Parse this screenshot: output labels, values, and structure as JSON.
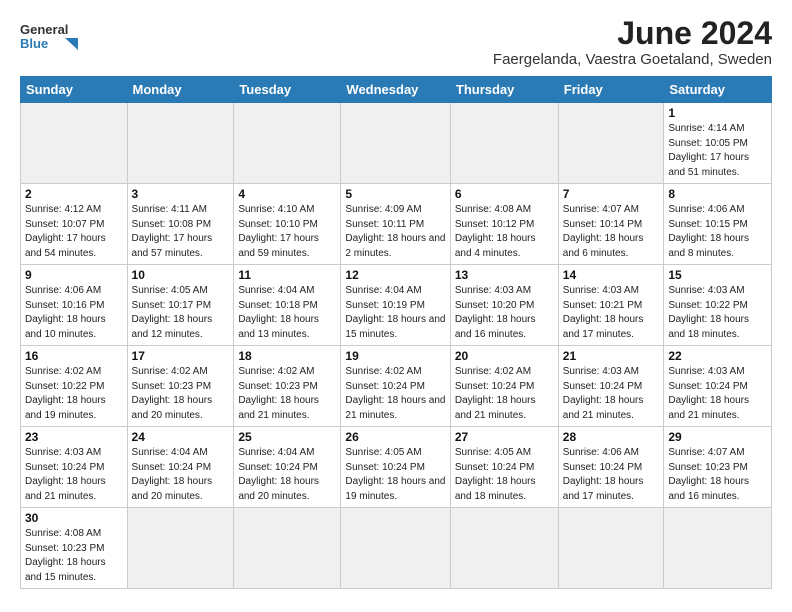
{
  "header": {
    "logo_general": "General",
    "logo_blue": "Blue",
    "month_title": "June 2024",
    "subtitle": "Faergelanda, Vaestra Goetaland, Sweden"
  },
  "weekdays": [
    "Sunday",
    "Monday",
    "Tuesday",
    "Wednesday",
    "Thursday",
    "Friday",
    "Saturday"
  ],
  "weeks": [
    [
      {
        "day": "",
        "info": ""
      },
      {
        "day": "",
        "info": ""
      },
      {
        "day": "",
        "info": ""
      },
      {
        "day": "",
        "info": ""
      },
      {
        "day": "",
        "info": ""
      },
      {
        "day": "",
        "info": ""
      },
      {
        "day": "1",
        "info": "Sunrise: 4:14 AM\nSunset: 10:05 PM\nDaylight: 17 hours and 51 minutes."
      }
    ],
    [
      {
        "day": "2",
        "info": "Sunrise: 4:12 AM\nSunset: 10:07 PM\nDaylight: 17 hours and 54 minutes."
      },
      {
        "day": "3",
        "info": "Sunrise: 4:11 AM\nSunset: 10:08 PM\nDaylight: 17 hours and 57 minutes."
      },
      {
        "day": "4",
        "info": "Sunrise: 4:10 AM\nSunset: 10:10 PM\nDaylight: 17 hours and 59 minutes."
      },
      {
        "day": "5",
        "info": "Sunrise: 4:09 AM\nSunset: 10:11 PM\nDaylight: 18 hours and 2 minutes."
      },
      {
        "day": "6",
        "info": "Sunrise: 4:08 AM\nSunset: 10:12 PM\nDaylight: 18 hours and 4 minutes."
      },
      {
        "day": "7",
        "info": "Sunrise: 4:07 AM\nSunset: 10:14 PM\nDaylight: 18 hours and 6 minutes."
      },
      {
        "day": "8",
        "info": "Sunrise: 4:06 AM\nSunset: 10:15 PM\nDaylight: 18 hours and 8 minutes."
      }
    ],
    [
      {
        "day": "9",
        "info": "Sunrise: 4:06 AM\nSunset: 10:16 PM\nDaylight: 18 hours and 10 minutes."
      },
      {
        "day": "10",
        "info": "Sunrise: 4:05 AM\nSunset: 10:17 PM\nDaylight: 18 hours and 12 minutes."
      },
      {
        "day": "11",
        "info": "Sunrise: 4:04 AM\nSunset: 10:18 PM\nDaylight: 18 hours and 13 minutes."
      },
      {
        "day": "12",
        "info": "Sunrise: 4:04 AM\nSunset: 10:19 PM\nDaylight: 18 hours and 15 minutes."
      },
      {
        "day": "13",
        "info": "Sunrise: 4:03 AM\nSunset: 10:20 PM\nDaylight: 18 hours and 16 minutes."
      },
      {
        "day": "14",
        "info": "Sunrise: 4:03 AM\nSunset: 10:21 PM\nDaylight: 18 hours and 17 minutes."
      },
      {
        "day": "15",
        "info": "Sunrise: 4:03 AM\nSunset: 10:22 PM\nDaylight: 18 hours and 18 minutes."
      }
    ],
    [
      {
        "day": "16",
        "info": "Sunrise: 4:02 AM\nSunset: 10:22 PM\nDaylight: 18 hours and 19 minutes."
      },
      {
        "day": "17",
        "info": "Sunrise: 4:02 AM\nSunset: 10:23 PM\nDaylight: 18 hours and 20 minutes."
      },
      {
        "day": "18",
        "info": "Sunrise: 4:02 AM\nSunset: 10:23 PM\nDaylight: 18 hours and 21 minutes."
      },
      {
        "day": "19",
        "info": "Sunrise: 4:02 AM\nSunset: 10:24 PM\nDaylight: 18 hours and 21 minutes."
      },
      {
        "day": "20",
        "info": "Sunrise: 4:02 AM\nSunset: 10:24 PM\nDaylight: 18 hours and 21 minutes."
      },
      {
        "day": "21",
        "info": "Sunrise: 4:03 AM\nSunset: 10:24 PM\nDaylight: 18 hours and 21 minutes."
      },
      {
        "day": "22",
        "info": "Sunrise: 4:03 AM\nSunset: 10:24 PM\nDaylight: 18 hours and 21 minutes."
      }
    ],
    [
      {
        "day": "23",
        "info": "Sunrise: 4:03 AM\nSunset: 10:24 PM\nDaylight: 18 hours and 21 minutes."
      },
      {
        "day": "24",
        "info": "Sunrise: 4:04 AM\nSunset: 10:24 PM\nDaylight: 18 hours and 20 minutes."
      },
      {
        "day": "25",
        "info": "Sunrise: 4:04 AM\nSunset: 10:24 PM\nDaylight: 18 hours and 20 minutes."
      },
      {
        "day": "26",
        "info": "Sunrise: 4:05 AM\nSunset: 10:24 PM\nDaylight: 18 hours and 19 minutes."
      },
      {
        "day": "27",
        "info": "Sunrise: 4:05 AM\nSunset: 10:24 PM\nDaylight: 18 hours and 18 minutes."
      },
      {
        "day": "28",
        "info": "Sunrise: 4:06 AM\nSunset: 10:24 PM\nDaylight: 18 hours and 17 minutes."
      },
      {
        "day": "29",
        "info": "Sunrise: 4:07 AM\nSunset: 10:23 PM\nDaylight: 18 hours and 16 minutes."
      }
    ],
    [
      {
        "day": "30",
        "info": "Sunrise: 4:08 AM\nSunset: 10:23 PM\nDaylight: 18 hours and 15 minutes."
      },
      {
        "day": "",
        "info": ""
      },
      {
        "day": "",
        "info": ""
      },
      {
        "day": "",
        "info": ""
      },
      {
        "day": "",
        "info": ""
      },
      {
        "day": "",
        "info": ""
      },
      {
        "day": "",
        "info": ""
      }
    ]
  ]
}
